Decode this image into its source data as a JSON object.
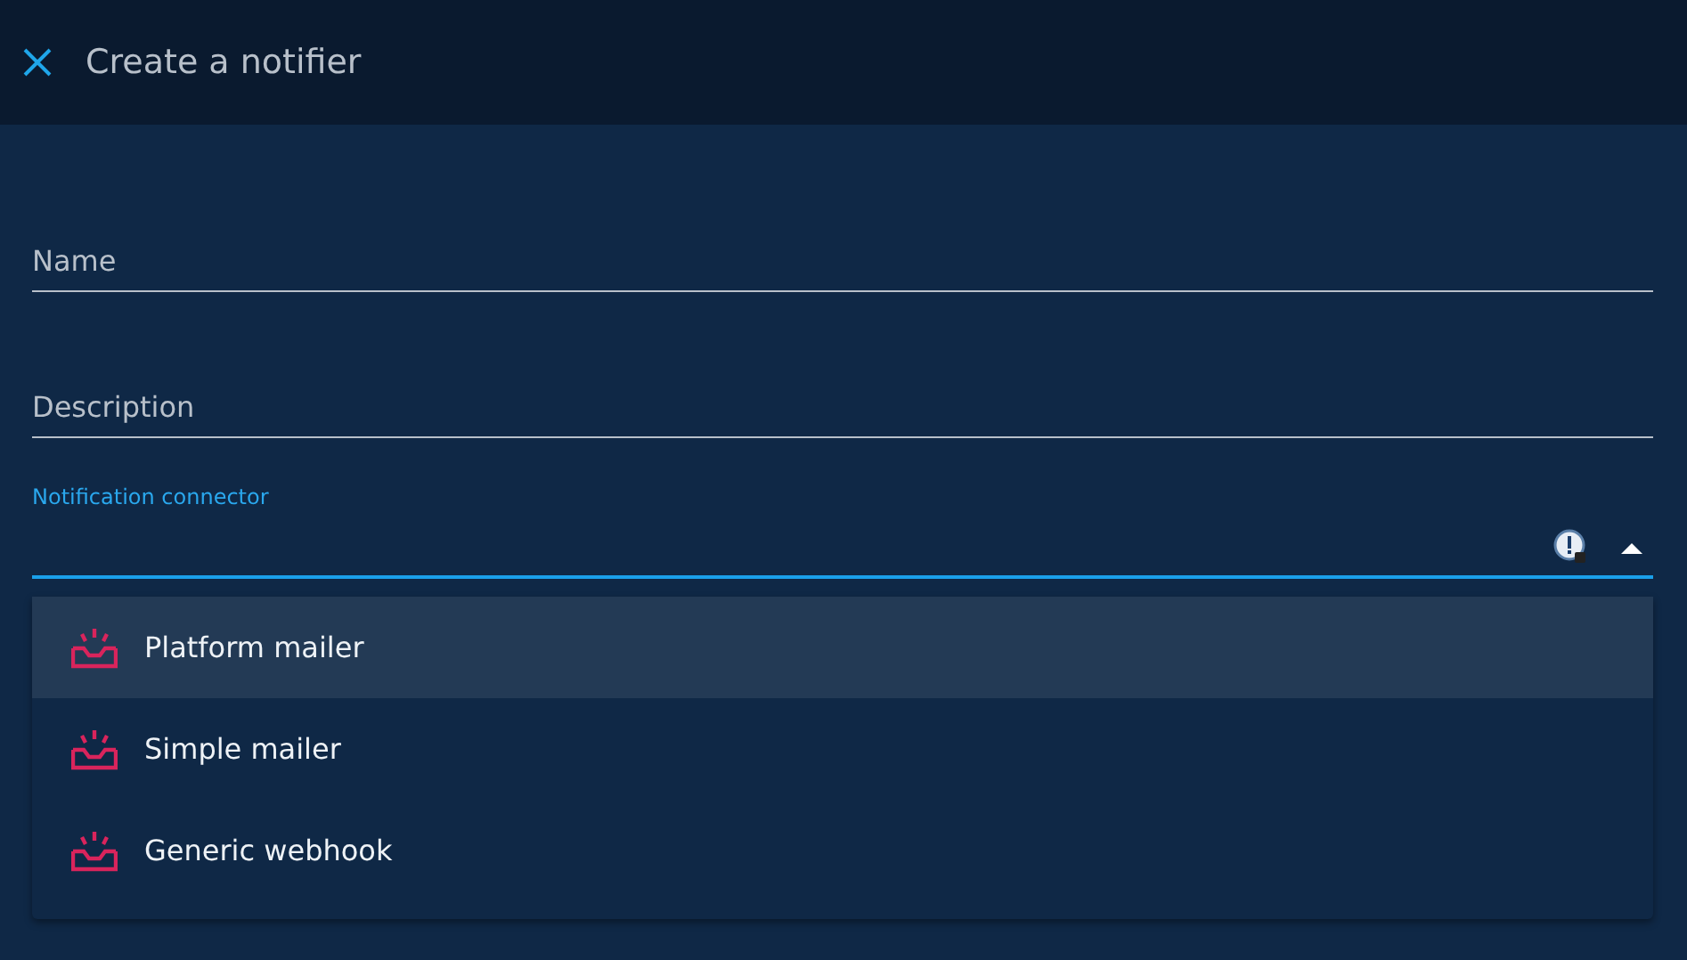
{
  "header": {
    "title": "Create a notifier"
  },
  "fields": [
    {
      "placeholder": "Name"
    },
    {
      "placeholder": "Description"
    }
  ],
  "connector": {
    "label": "Notification connector",
    "expanded": true,
    "options": [
      {
        "label": "Platform mailer",
        "selected": true
      },
      {
        "label": "Simple mailer",
        "selected": false
      },
      {
        "label": "Generic webhook",
        "selected": false
      }
    ]
  }
}
